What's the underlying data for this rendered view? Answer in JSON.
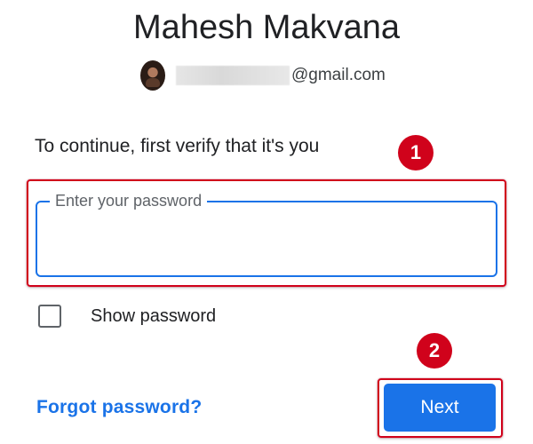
{
  "account": {
    "name": "Mahesh Makvana",
    "email_domain": "@gmail.com",
    "avatar_icon": "user-avatar"
  },
  "prompt": "To continue, first verify that it's you",
  "password": {
    "label": "Enter your password",
    "value": ""
  },
  "show_password": {
    "label": "Show password",
    "checked": false
  },
  "actions": {
    "forgot_label": "Forgot password?",
    "next_label": "Next"
  },
  "annotations": {
    "step1": "1",
    "step2": "2",
    "highlight_color": "#d0021b"
  },
  "colors": {
    "accent": "#1a73e8",
    "text": "#202124",
    "muted": "#5f6368"
  }
}
